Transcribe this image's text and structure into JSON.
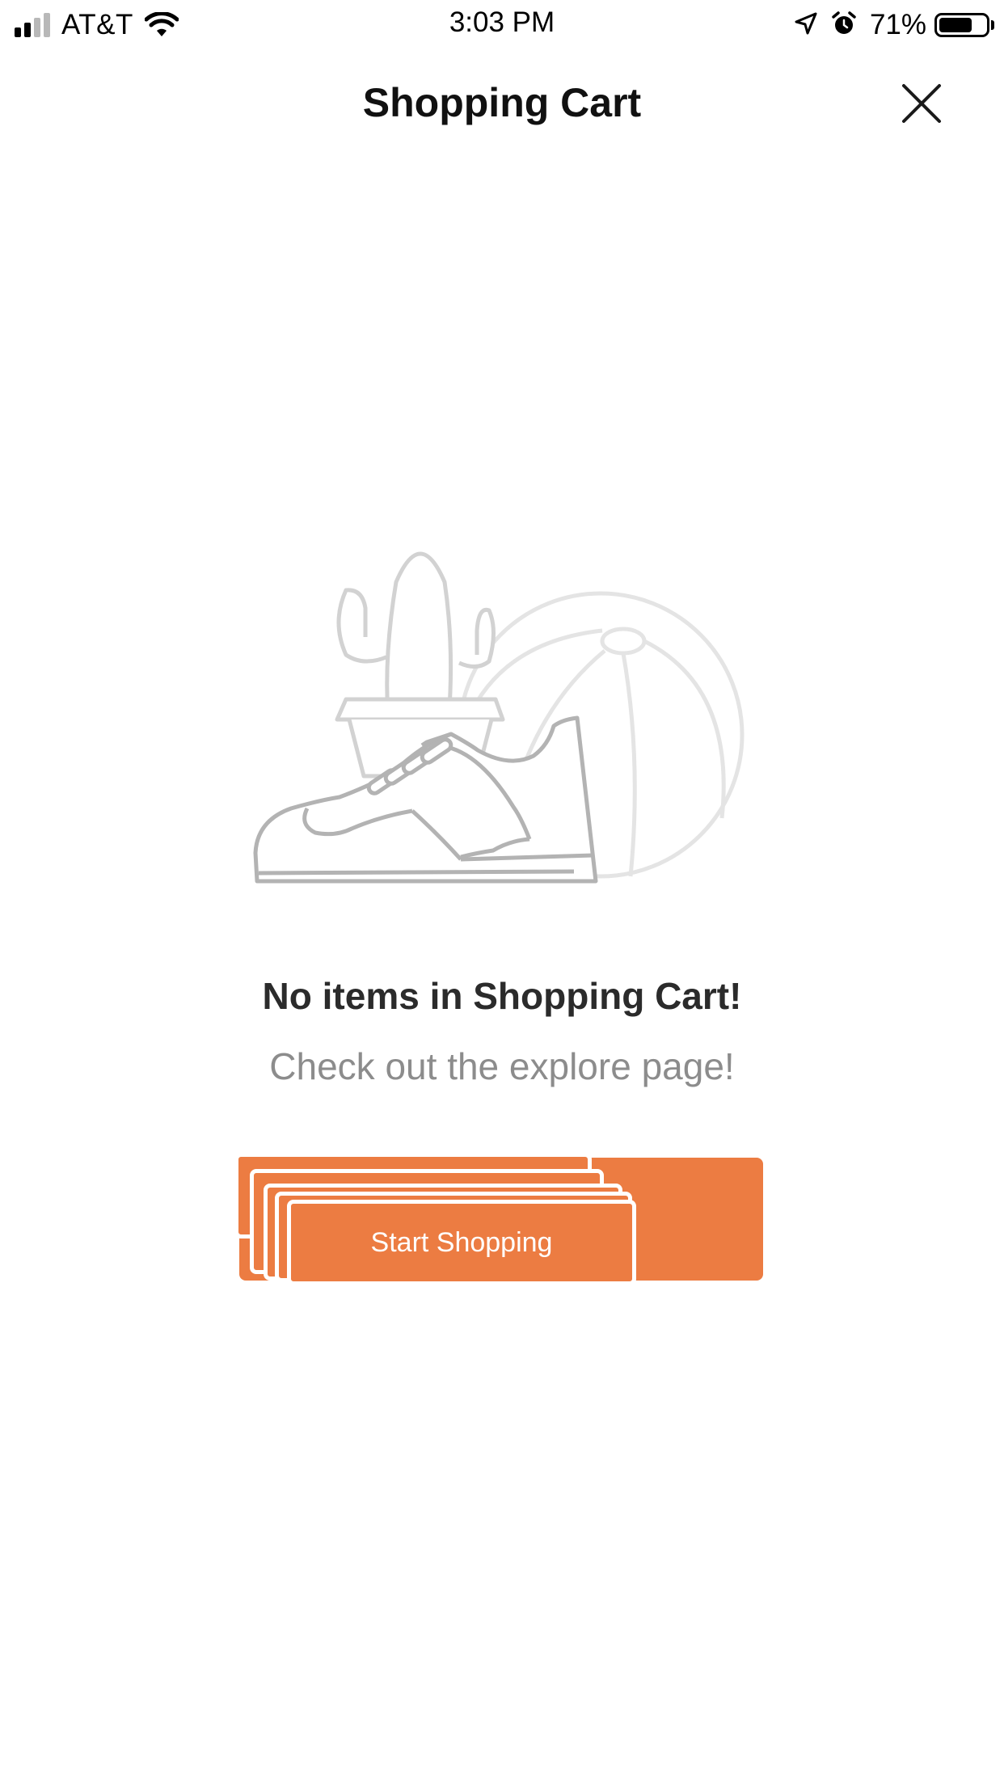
{
  "status_bar": {
    "carrier": "AT&T",
    "time": "3:03 PM",
    "battery_percent": "71%",
    "battery_level": 0.71,
    "icons": [
      "signal-icon",
      "wifi-icon",
      "location-icon",
      "alarm-icon",
      "battery-icon"
    ]
  },
  "header": {
    "title": "Shopping Cart",
    "close_icon": "close-icon"
  },
  "empty_state": {
    "illustration_icon": "empty-cart-illustration",
    "title": "No items in Shopping Cart!",
    "subtitle": "Check out the explore page!",
    "button_label": "Start Shopping"
  },
  "colors": {
    "accent": "#ec7c42",
    "title_text": "#2b2b2b",
    "subtitle_text": "#8c8c8c",
    "illustration_dark": "#b5b5b5",
    "illustration_light": "#e4e4e4"
  }
}
